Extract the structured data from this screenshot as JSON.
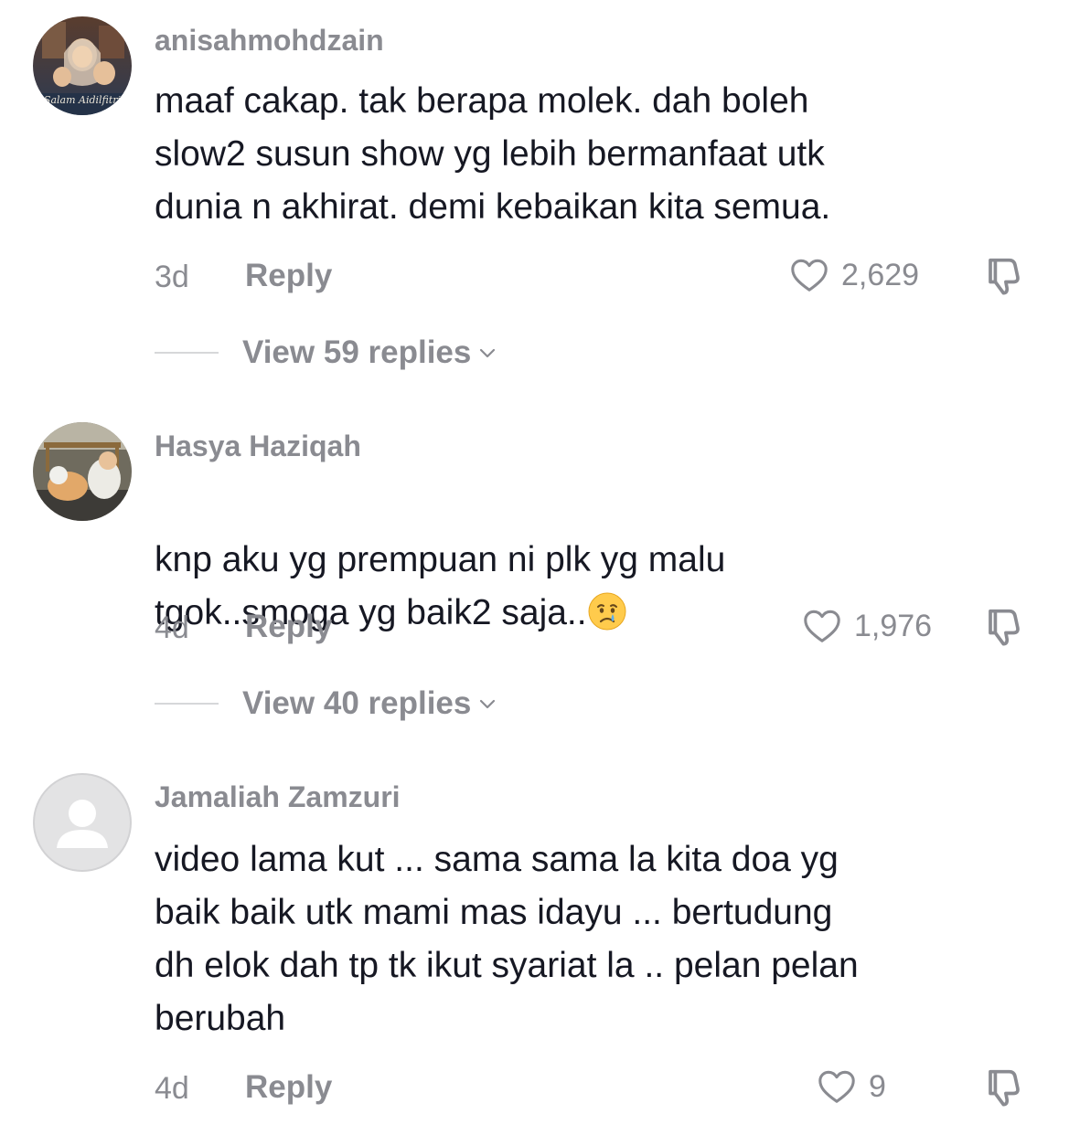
{
  "comments": [
    {
      "username": "anisahmohdzain",
      "avatar_caption": "Salam Aidilfitri",
      "text": "maaf cakap. tak berapa molek. dah boleh\nslow2 susun show yg lebih bermanfaat utk\ndunia n akhirat. demi kebaikan kita semua.",
      "age": "3d",
      "reply_label": "Reply",
      "likes": "2,629",
      "view_replies": "View 59 replies"
    },
    {
      "username": "Hasya Haziqah",
      "text": "knp aku yg prempuan ni plk yg malu\ntgok..smoga yg baik2 saja..",
      "emoji": "crying-face",
      "age": "4d",
      "reply_label": "Reply",
      "likes": "1,976",
      "view_replies": "View 40 replies"
    },
    {
      "username": "Jamaliah Zamzuri",
      "text": "video lama kut ... sama sama la kita doa yg\nbaik baik utk mami mas idayu ... bertudung\ndh elok dah tp tk ikut syariat la .. pelan pelan\nberubah",
      "age": "4d",
      "reply_label": "Reply",
      "likes": "9"
    }
  ],
  "colors": {
    "text_primary": "#161823",
    "text_secondary": "#8a8b91",
    "divider": "#d6d7d9"
  },
  "icons": [
    "heart-outline-icon",
    "thumbs-down-icon",
    "chevron-down-icon",
    "crying-face-emoji",
    "default-avatar-icon"
  ]
}
